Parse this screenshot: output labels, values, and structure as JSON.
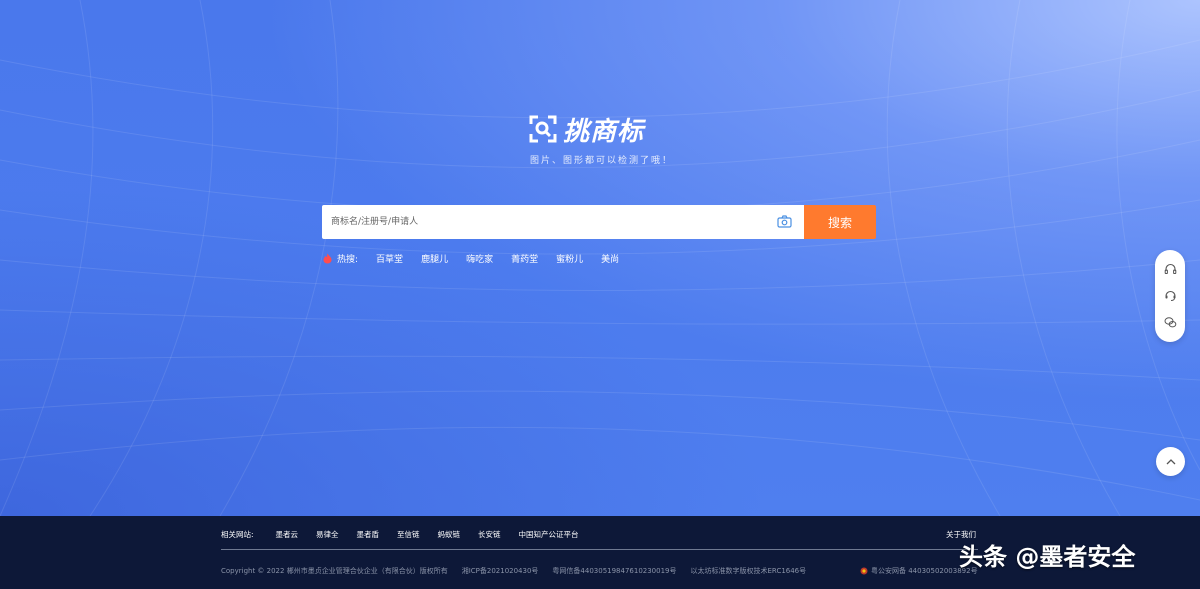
{
  "brand": {
    "logo_text": "挑商标",
    "slogan": "图片、图形都可以检测了哦！"
  },
  "search": {
    "placeholder": "商标名/注册号/申请人",
    "button_label": "搜索",
    "camera_icon": "camera-icon"
  },
  "hot": {
    "label": "热搜:",
    "items": [
      "百草堂",
      "鹿腿儿",
      "嗨吃家",
      "菁药堂",
      "蜜粉儿",
      "美尚"
    ]
  },
  "side_tools": {
    "icons": [
      "headset-icon",
      "support-icon",
      "wechat-icon"
    ],
    "back_to_top_icon": "chevron-up-icon"
  },
  "footer": {
    "related_label": "相关网站:",
    "related_links": [
      "墨者云",
      "易律全",
      "墨者盾",
      "至信链",
      "蚂蚁链",
      "长安链",
      "中国知产公证平台"
    ],
    "about": "关于我们",
    "copyright": "Copyright © 2022 郴州市墨贞企业管理合伙企业（有限合伙）版权所有",
    "icp": "湘ICP备2021020430号",
    "telecom": "粤网信备44030519847610230019号",
    "tech": "以太坊标准数字版权技术ERC1646号",
    "police": "粤公安网备 44030502003892号"
  },
  "watermark": "头条 @墨者安全",
  "colors": {
    "accent": "#ff7a2e",
    "hero_blue": "#4c7bee",
    "footer_bg": "#0d1838"
  }
}
